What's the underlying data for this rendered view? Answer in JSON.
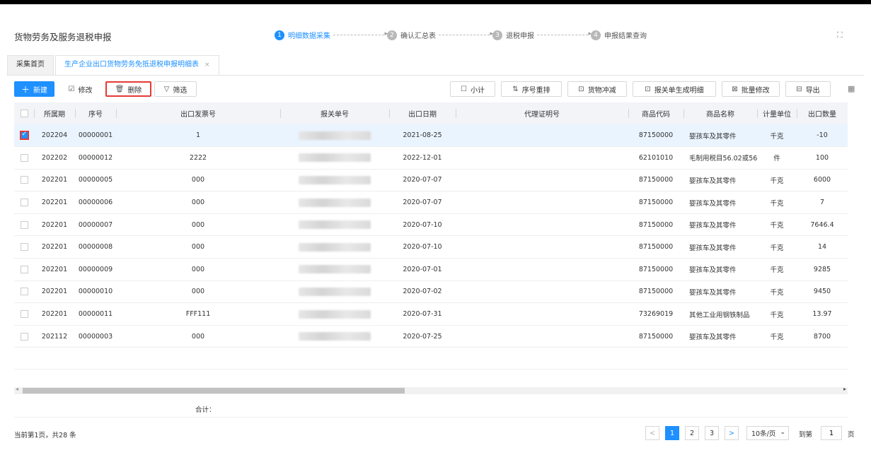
{
  "header": {
    "app_title": "货物劳务及服务退税申报",
    "steps": [
      {
        "num": "1",
        "label": "明细数据采集"
      },
      {
        "num": "2",
        "label": "确认汇总表"
      },
      {
        "num": "3",
        "label": "退税申报"
      },
      {
        "num": "4",
        "label": "申报结果查询"
      }
    ]
  },
  "tabs": [
    {
      "label": "采集首页"
    },
    {
      "label": "生产企业出口货物劳务免抵退税申报明细表",
      "close": "×"
    }
  ],
  "toolbar": {
    "new_label": "新建",
    "edit_label": "修改",
    "delete_label": "删除",
    "filter_label": "筛选",
    "subtotal_label": "小计",
    "reorder_label": "序号重排",
    "offset_label": "货物冲减",
    "generate_label": "报关单生成明细",
    "batch_edit_label": "批量修改",
    "export_label": "导出"
  },
  "table": {
    "columns": [
      "所属期",
      "序号",
      "出口发票号",
      "报关单号",
      "出口日期",
      "代理证明号",
      "商品代码",
      "商品名称",
      "计量单位",
      "出口数量"
    ],
    "rows": [
      {
        "period": "202204",
        "seq": "00000001",
        "invoice": "1",
        "date": "2021-08-25",
        "code": "87150000",
        "name": "婴孩车及其零件",
        "unit": "千克",
        "qty": "-10"
      },
      {
        "period": "202202",
        "seq": "00000012",
        "invoice": "2222",
        "date": "2022-12-01",
        "code": "62101010",
        "name": "毛制用税目56.02或56.",
        "unit": "件",
        "qty": "100"
      },
      {
        "period": "202201",
        "seq": "00000005",
        "invoice": "000",
        "date": "2020-07-07",
        "code": "87150000",
        "name": "婴孩车及其零件",
        "unit": "千克",
        "qty": "6000"
      },
      {
        "period": "202201",
        "seq": "00000006",
        "invoice": "000",
        "date": "2020-07-07",
        "code": "87150000",
        "name": "婴孩车及其零件",
        "unit": "千克",
        "qty": "7"
      },
      {
        "period": "202201",
        "seq": "00000007",
        "invoice": "000",
        "date": "2020-07-10",
        "code": "87150000",
        "name": "婴孩车及其零件",
        "unit": "千克",
        "qty": "7646.4"
      },
      {
        "period": "202201",
        "seq": "00000008",
        "invoice": "000",
        "date": "2020-07-10",
        "code": "87150000",
        "name": "婴孩车及其零件",
        "unit": "千克",
        "qty": "14"
      },
      {
        "period": "202201",
        "seq": "00000009",
        "invoice": "000",
        "date": "2020-07-01",
        "code": "87150000",
        "name": "婴孩车及其零件",
        "unit": "千克",
        "qty": "9285"
      },
      {
        "period": "202201",
        "seq": "00000010",
        "invoice": "000",
        "date": "2020-07-02",
        "code": "87150000",
        "name": "婴孩车及其零件",
        "unit": "千克",
        "qty": "9450"
      },
      {
        "period": "202201",
        "seq": "00000011",
        "invoice": "FFF111",
        "date": "2020-07-31",
        "code": "73269019",
        "name": "其他工业用钢铁制品",
        "unit": "千克",
        "qty": "13.97"
      },
      {
        "period": "202112",
        "seq": "00000003",
        "invoice": "000",
        "date": "2020-07-25",
        "code": "87150000",
        "name": "婴孩车及其零件",
        "unit": "千克",
        "qty": "8700"
      }
    ],
    "total_label": "合计："
  },
  "pagination": {
    "info": "当前第1页，共28 条",
    "pages": [
      "1",
      "2",
      "3"
    ],
    "page_size": "10条/页",
    "goto_label": "到第",
    "goto_value": "1",
    "page_label": "页"
  }
}
